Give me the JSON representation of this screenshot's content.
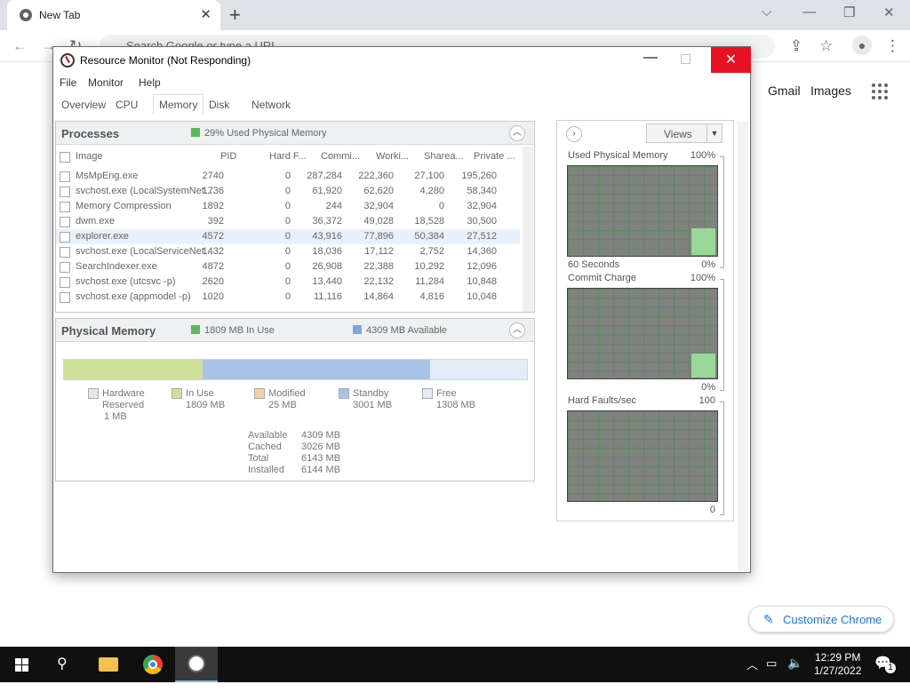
{
  "browser": {
    "tab_title": "New Tab",
    "tab_close": "✕",
    "new_tab": "+",
    "omnibox_placeholder": "Search Google or type a URL",
    "links": [
      "Gmail",
      "Images"
    ],
    "customize_label": "Customize Chrome"
  },
  "window": {
    "title": "Resource Monitor (Not Responding)",
    "menu": [
      "File",
      "Monitor",
      "Help"
    ],
    "tabs": [
      "Overview",
      "CPU",
      "Memory",
      "Disk",
      "Network"
    ],
    "active_tab": "Memory"
  },
  "processes": {
    "title": "Processes",
    "summary": "29% Used Physical Memory",
    "columns": [
      "Image",
      "PID",
      "Hard F...",
      "Commi...",
      "Worki...",
      "Sharea...",
      "Private ..."
    ],
    "rows": [
      [
        "MsMpEng.exe",
        "2740",
        "0",
        "287,284",
        "222,360",
        "27,100",
        "195,260"
      ],
      [
        "svchost.exe (LocalSystemNet...",
        "1736",
        "0",
        "61,920",
        "62,620",
        "4,280",
        "58,340"
      ],
      [
        "Memory Compression",
        "1892",
        "0",
        "244",
        "32,904",
        "0",
        "32,904"
      ],
      [
        "dwm.exe",
        "392",
        "0",
        "36,372",
        "49,028",
        "18,528",
        "30,500"
      ],
      [
        "explorer.exe",
        "4572",
        "0",
        "43,916",
        "77,896",
        "50,384",
        "27,512"
      ],
      [
        "svchost.exe (LocalServiceNet...",
        "1432",
        "0",
        "18,036",
        "17,112",
        "2,752",
        "14,360"
      ],
      [
        "SearchIndexer.exe",
        "4872",
        "0",
        "26,908",
        "22,388",
        "10,292",
        "12,096"
      ],
      [
        "svchost.exe (utcsvc -p)",
        "2620",
        "0",
        "13,440",
        "22,132",
        "11,284",
        "10,848"
      ],
      [
        "svchost.exe (appmodel -p)",
        "1020",
        "0",
        "11,116",
        "14,864",
        "4,816",
        "10,048"
      ]
    ],
    "selected_row": 4
  },
  "physical_memory": {
    "title": "Physical Memory",
    "in_use": "1809 MB In Use",
    "available": "4309 MB Available",
    "bar_fractions": {
      "in_use": 0.3,
      "standby": 0.49,
      "free": 0.21
    },
    "legend": [
      {
        "name": "Hardware Reserved",
        "value": "1 MB",
        "color": "#e6e6e6"
      },
      {
        "name": "In Use",
        "value": "1809 MB",
        "color": "#cfe09a"
      },
      {
        "name": "Modified",
        "value": "25 MB",
        "color": "#f3d39b"
      },
      {
        "name": "Standby",
        "value": "3001 MB",
        "color": "#a9c2e8"
      },
      {
        "name": "Free",
        "value": "1308 MB",
        "color": "#e3ecf8"
      }
    ],
    "stats_labels": [
      "Available",
      "Cached",
      "Total",
      "Installed"
    ],
    "stats_values": [
      "4309 MB",
      "3026 MB",
      "6143 MB",
      "6144 MB"
    ]
  },
  "graphs_panel": {
    "views_label": "Views",
    "graphs": [
      {
        "title": "Used Physical Memory",
        "max": "100%",
        "footer_left": "60 Seconds",
        "footer_right": "0%"
      },
      {
        "title": "Commit Charge",
        "max": "100%",
        "footer_left": "",
        "footer_right": "0%"
      },
      {
        "title": "Hard Faults/sec",
        "max": "100",
        "footer_left": "",
        "footer_right": "0"
      }
    ]
  },
  "taskbar": {
    "time": "12:29 PM",
    "date": "1/27/2022",
    "notification_count": "1"
  },
  "colors": {
    "accent_close": "#e81123",
    "chrome_blue": "#1a73e8",
    "in_use": "#cfe09a",
    "standby": "#a9c2e8",
    "free": "#e3ecf8"
  }
}
